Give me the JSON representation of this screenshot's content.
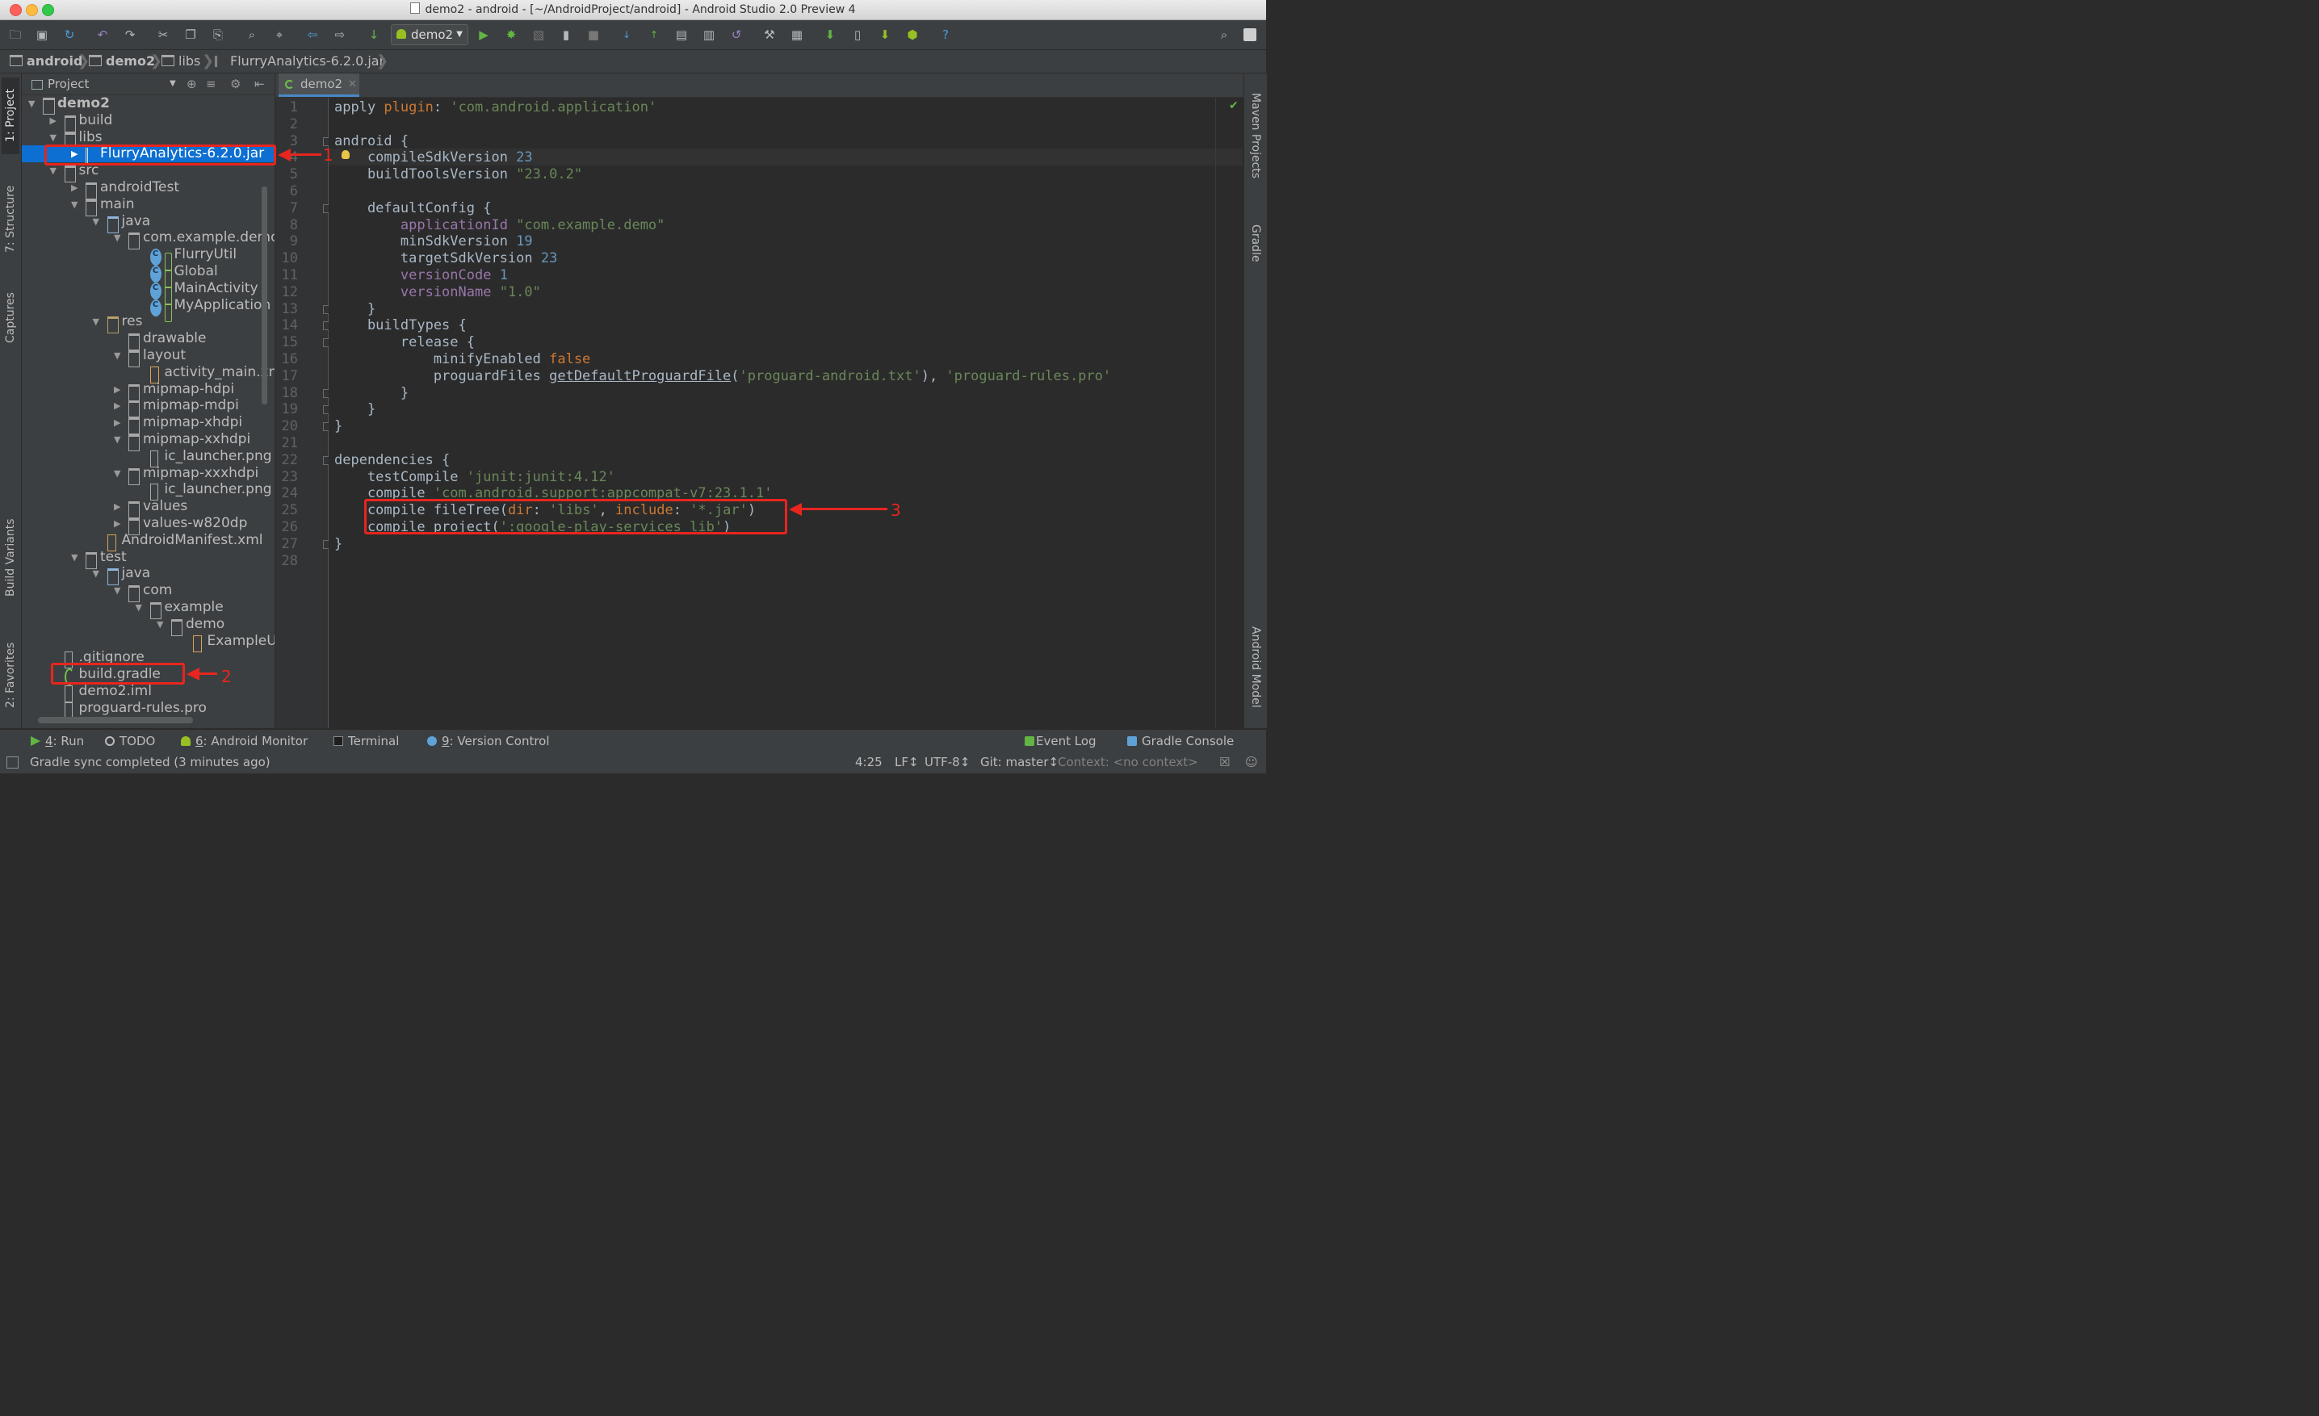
{
  "window": {
    "title": "demo2 - android - [~/AndroidProject/android] - Android Studio 2.0 Preview 4"
  },
  "toolbar": {
    "run_config": "demo2"
  },
  "breadcrumb": [
    "android",
    "demo2",
    "libs",
    "FlurryAnalytics-6.2.0.jar"
  ],
  "left_tool_tabs": [
    "1: Project",
    "7: Structure",
    "Captures",
    "Build Variants",
    "2: Favorites"
  ],
  "right_tool_tabs": [
    "Maven Projects",
    "Gradle",
    "Android Model"
  ],
  "project_panel": {
    "header": "Project",
    "tree": [
      {
        "label": "demo2",
        "depth": 0,
        "arrow": "open",
        "icon": "module",
        "bold": true
      },
      {
        "label": "build",
        "depth": 1,
        "arrow": "closed",
        "icon": "folder"
      },
      {
        "label": "libs",
        "depth": 1,
        "arrow": "open",
        "icon": "folder"
      },
      {
        "label": "FlurryAnalytics-6.2.0.jar",
        "depth": 2,
        "arrow": "closed",
        "icon": "jar",
        "selected": true
      },
      {
        "label": "src",
        "depth": 1,
        "arrow": "open",
        "icon": "folder"
      },
      {
        "label": "androidTest",
        "depth": 2,
        "arrow": "closed",
        "icon": "folder"
      },
      {
        "label": "main",
        "depth": 2,
        "arrow": "open",
        "icon": "folder"
      },
      {
        "label": "java",
        "depth": 3,
        "arrow": "open",
        "icon": "src"
      },
      {
        "label": "com.example.demo",
        "depth": 4,
        "arrow": "open",
        "icon": "folder"
      },
      {
        "label": "FlurryUtil",
        "depth": 5,
        "arrow": "",
        "icon": "class"
      },
      {
        "label": "Global",
        "depth": 5,
        "arrow": "",
        "icon": "class"
      },
      {
        "label": "MainActivity",
        "depth": 5,
        "arrow": "",
        "icon": "class"
      },
      {
        "label": "MyApplication",
        "depth": 5,
        "arrow": "",
        "icon": "class"
      },
      {
        "label": "res",
        "depth": 3,
        "arrow": "open",
        "icon": "res"
      },
      {
        "label": "drawable",
        "depth": 4,
        "arrow": "",
        "icon": "folder"
      },
      {
        "label": "layout",
        "depth": 4,
        "arrow": "open",
        "icon": "folder"
      },
      {
        "label": "activity_main.xml",
        "depth": 5,
        "arrow": "",
        "icon": "xml"
      },
      {
        "label": "mipmap-hdpi",
        "depth": 4,
        "arrow": "closed",
        "icon": "folder"
      },
      {
        "label": "mipmap-mdpi",
        "depth": 4,
        "arrow": "closed",
        "icon": "folder"
      },
      {
        "label": "mipmap-xhdpi",
        "depth": 4,
        "arrow": "closed",
        "icon": "folder"
      },
      {
        "label": "mipmap-xxhdpi",
        "depth": 4,
        "arrow": "open",
        "icon": "folder"
      },
      {
        "label": "ic_launcher.png",
        "depth": 5,
        "arrow": "",
        "icon": "file"
      },
      {
        "label": "mipmap-xxxhdpi",
        "depth": 4,
        "arrow": "open",
        "icon": "folder"
      },
      {
        "label": "ic_launcher.png",
        "depth": 5,
        "arrow": "",
        "icon": "file"
      },
      {
        "label": "values",
        "depth": 4,
        "arrow": "closed",
        "icon": "folder"
      },
      {
        "label": "values-w820dp",
        "depth": 4,
        "arrow": "closed",
        "icon": "folder"
      },
      {
        "label": "AndroidManifest.xml",
        "depth": 3,
        "arrow": "",
        "icon": "xml"
      },
      {
        "label": "test",
        "depth": 2,
        "arrow": "open",
        "icon": "folder"
      },
      {
        "label": "java",
        "depth": 3,
        "arrow": "open",
        "icon": "src"
      },
      {
        "label": "com",
        "depth": 4,
        "arrow": "open",
        "icon": "folder"
      },
      {
        "label": "example",
        "depth": 5,
        "arrow": "open",
        "icon": "folder"
      },
      {
        "label": "demo",
        "depth": 6,
        "arrow": "open",
        "icon": "folder"
      },
      {
        "label": "ExampleUnitTest",
        "depth": 7,
        "arrow": "",
        "icon": "xml"
      },
      {
        "label": ".gitignore",
        "depth": 1,
        "arrow": "",
        "icon": "file"
      },
      {
        "label": "build.gradle",
        "depth": 1,
        "arrow": "",
        "icon": "gradle"
      },
      {
        "label": "demo2.iml",
        "depth": 1,
        "arrow": "",
        "icon": "file"
      },
      {
        "label": "proguard-rules.pro",
        "depth": 1,
        "arrow": "",
        "icon": "file"
      }
    ]
  },
  "editor": {
    "tab": "demo2",
    "code_lines": [
      [
        [
          "nm",
          "apply "
        ],
        [
          "kw",
          "plugin"
        ],
        [
          "nm",
          ": "
        ],
        [
          "str",
          "'com.android.application'"
        ]
      ],
      [],
      [
        [
          "nm",
          "android {"
        ]
      ],
      [
        [
          "nm",
          "    compileSdkVersion "
        ],
        [
          "num",
          "23"
        ]
      ],
      [
        [
          "nm",
          "    buildToolsVersion "
        ],
        [
          "str",
          "\"23.0.2\""
        ]
      ],
      [],
      [
        [
          "nm",
          "    defaultConfig {"
        ]
      ],
      [
        [
          "prop",
          "        applicationId "
        ],
        [
          "str",
          "\"com.example.demo\""
        ]
      ],
      [
        [
          "nm",
          "        minSdkVersion "
        ],
        [
          "num",
          "19"
        ]
      ],
      [
        [
          "nm",
          "        targetSdkVersion "
        ],
        [
          "num",
          "23"
        ]
      ],
      [
        [
          "prop",
          "        versionCode "
        ],
        [
          "num",
          "1"
        ]
      ],
      [
        [
          "prop",
          "        versionName "
        ],
        [
          "str",
          "\"1.0\""
        ]
      ],
      [
        [
          "nm",
          "    }"
        ]
      ],
      [
        [
          "nm",
          "    buildTypes {"
        ]
      ],
      [
        [
          "nm",
          "        release {"
        ]
      ],
      [
        [
          "nm",
          "            minifyEnabled "
        ],
        [
          "kw",
          "false"
        ]
      ],
      [
        [
          "nm",
          "            proguardFiles "
        ],
        [
          "mth",
          "getDefaultProguardFile"
        ],
        [
          "nm",
          "("
        ],
        [
          "str",
          "'proguard-android.txt'"
        ],
        [
          "nm",
          "), "
        ],
        [
          "str",
          "'proguard-rules.pro'"
        ]
      ],
      [
        [
          "nm",
          "        }"
        ]
      ],
      [
        [
          "nm",
          "    }"
        ]
      ],
      [
        [
          "nm",
          "}"
        ]
      ],
      [],
      [
        [
          "nm",
          "dependencies {"
        ]
      ],
      [
        [
          "nm",
          "    testCompile "
        ],
        [
          "str",
          "'junit:junit:4.12'"
        ]
      ],
      [
        [
          "nm",
          "    compile "
        ],
        [
          "str",
          "'com.android.support:appcompat-v7:23.1.1'"
        ]
      ],
      [
        [
          "nm",
          "    compile fileTree("
        ],
        [
          "kw",
          "dir"
        ],
        [
          "nm",
          ": "
        ],
        [
          "str",
          "'libs'"
        ],
        [
          "nm",
          ", "
        ],
        [
          "kw",
          "include"
        ],
        [
          "nm",
          ": "
        ],
        [
          "str",
          "'*.jar'"
        ],
        [
          "nm",
          ")"
        ]
      ],
      [
        [
          "nm",
          "    compile project("
        ],
        [
          "str",
          "':google-play-services_lib'"
        ],
        [
          "nm",
          ")"
        ]
      ],
      [
        [
          "nm",
          "}"
        ]
      ],
      []
    ]
  },
  "annotations": {
    "n1": "1",
    "n2": "2",
    "n3": "3"
  },
  "bottom_tabs": {
    "run_num": "4",
    "run": ": Run",
    "todo": "TODO",
    "monitor_num": "6",
    "monitor": ": Android Monitor",
    "terminal": "Terminal",
    "vcs_num": "9",
    "vcs": ": Version Control",
    "event_log": "Event Log",
    "gradle_console": "Gradle Console"
  },
  "status": {
    "message": "Gradle sync completed (3 minutes ago)",
    "position": "4:25",
    "line_sep": "LF↕",
    "encoding": "UTF-8↕",
    "git": "Git: master↕",
    "context": "Context: <no context>"
  },
  "colors": {
    "keyword": "#cc7832",
    "string": "#6a8759",
    "number": "#6897bb",
    "property": "#9876aa",
    "selection": "#0d6fd1",
    "annotation": "#e8251e"
  }
}
